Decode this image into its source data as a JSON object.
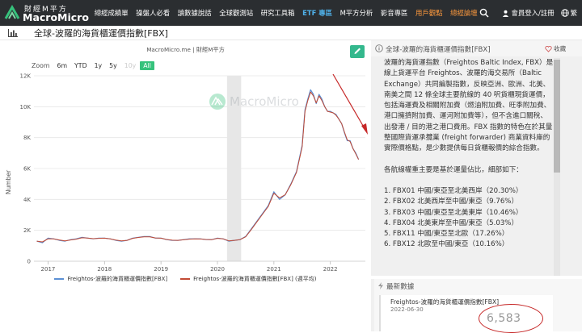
{
  "nav": {
    "logo_cn": "財經M平方",
    "logo_en": "MacroMicro",
    "items": [
      "總經成績單",
      "操盤人必看",
      "讀數據說話",
      "全球觀測站",
      "研究工具箱",
      "ETF 專區",
      "M平方分析",
      "影音專區",
      "用戶觀點",
      "總經論壇"
    ],
    "login": "會員登入/註冊",
    "lang": "繁"
  },
  "page": {
    "title": "全球-波羅的海貨櫃運價指數[FBX]"
  },
  "chart_header": {
    "source": "MacroMicro.me | 財經M平方",
    "zoom_label": "Zoom",
    "zoom_options": [
      "6m",
      "YTD",
      "1y",
      "5y",
      "10y",
      "All"
    ],
    "zoom_active": "All",
    "zoom_disabled": "10y",
    "watermark": "MacroMicro"
  },
  "chart_data": {
    "type": "line",
    "ylabel": "Number",
    "ylim": [
      0,
      12000
    ],
    "y_ticks": [
      "0",
      "2K",
      "4K",
      "6K",
      "8K",
      "10K",
      "12K"
    ],
    "x_ticks": [
      "2017",
      "2018",
      "2019",
      "2020",
      "2021",
      "2022"
    ],
    "x_tick_values": [
      2017,
      2018,
      2019,
      2020,
      2021,
      2022
    ],
    "xlim": [
      2016.75,
      2022.62
    ],
    "shaded_region": [
      2020.17,
      2020.42
    ],
    "series": [
      {
        "name": "Freightos-波羅的海貨櫃運價指數[FBX]",
        "color": "#5b8fd4",
        "x": [
          2016.8,
          2016.9,
          2017.0,
          2017.1,
          2017.2,
          2017.3,
          2017.4,
          2017.5,
          2017.6,
          2017.7,
          2017.8,
          2017.9,
          2018.0,
          2018.1,
          2018.2,
          2018.3,
          2018.4,
          2018.5,
          2018.6,
          2018.7,
          2018.8,
          2018.9,
          2019.0,
          2019.1,
          2019.2,
          2019.3,
          2019.4,
          2019.5,
          2019.6,
          2019.7,
          2019.8,
          2019.9,
          2020.0,
          2020.1,
          2020.2,
          2020.3,
          2020.4,
          2020.5,
          2020.6,
          2020.7,
          2020.8,
          2020.9,
          2021.0,
          2021.1,
          2021.2,
          2021.3,
          2021.4,
          2021.5,
          2021.55,
          2021.6,
          2021.65,
          2021.7,
          2021.75,
          2021.8,
          2021.85,
          2021.9,
          2021.95,
          2022.0,
          2022.05,
          2022.1,
          2022.15,
          2022.2,
          2022.25,
          2022.3,
          2022.35,
          2022.4,
          2022.45,
          2022.5
        ],
        "values": [
          1300,
          1200,
          1500,
          1450,
          1350,
          1300,
          1400,
          1450,
          1550,
          1500,
          1450,
          1500,
          1500,
          1450,
          1350,
          1300,
          1350,
          1500,
          1550,
          1600,
          1600,
          1500,
          1500,
          1400,
          1350,
          1350,
          1400,
          1450,
          1450,
          1450,
          1400,
          1400,
          1500,
          1450,
          1300,
          1350,
          1400,
          1600,
          2100,
          2600,
          3100,
          3600,
          4500,
          4000,
          4300,
          5000,
          5800,
          7500,
          9800,
          10500,
          11100,
          10800,
          10200,
          10800,
          10500,
          10000,
          9700,
          9700,
          9600,
          9500,
          9200,
          8900,
          8300,
          7800,
          7800,
          7300,
          7000,
          6583
        ]
      },
      {
        "name": "Freightos-波羅的海貨櫃運價指數[FBX] (週平均)",
        "color": "#c24a34",
        "x": [
          2016.8,
          2016.9,
          2017.0,
          2017.1,
          2017.2,
          2017.3,
          2017.4,
          2017.5,
          2017.6,
          2017.7,
          2017.8,
          2017.9,
          2018.0,
          2018.1,
          2018.2,
          2018.3,
          2018.4,
          2018.5,
          2018.6,
          2018.7,
          2018.8,
          2018.9,
          2019.0,
          2019.1,
          2019.2,
          2019.3,
          2019.4,
          2019.5,
          2019.6,
          2019.7,
          2019.8,
          2019.9,
          2020.0,
          2020.1,
          2020.2,
          2020.3,
          2020.4,
          2020.5,
          2020.6,
          2020.7,
          2020.8,
          2020.9,
          2021.0,
          2021.1,
          2021.2,
          2021.3,
          2021.4,
          2021.5,
          2021.55,
          2021.6,
          2021.65,
          2021.7,
          2021.75,
          2021.8,
          2021.85,
          2021.9,
          2021.95,
          2022.0,
          2022.05,
          2022.1,
          2022.15,
          2022.2,
          2022.25,
          2022.3,
          2022.35,
          2022.4,
          2022.45,
          2022.5
        ],
        "values": [
          1300,
          1250,
          1450,
          1450,
          1380,
          1320,
          1380,
          1430,
          1520,
          1500,
          1460,
          1480,
          1490,
          1450,
          1370,
          1320,
          1350,
          1480,
          1540,
          1580,
          1580,
          1510,
          1490,
          1410,
          1360,
          1350,
          1390,
          1430,
          1450,
          1440,
          1410,
          1400,
          1480,
          1450,
          1320,
          1350,
          1400,
          1580,
          2050,
          2550,
          3050,
          3550,
          4400,
          4100,
          4300,
          4950,
          5750,
          7400,
          9700,
          10400,
          10950,
          10700,
          10250,
          10700,
          10400,
          10000,
          9700,
          9650,
          9600,
          9450,
          9200,
          8900,
          8350,
          7850,
          7750,
          7300,
          6950,
          6583
        ]
      }
    ]
  },
  "right_panel": {
    "title": "全球-波羅的海貨櫃運價指數[FBX]",
    "fav_label": "收藏",
    "description": "波羅的海貨運指數（Freightos Baltic Index, FBX）是線上貨運平台 Freightos、波羅的海交易所（Baltic Exchange）共同編製指數，反映亞洲、歐洲、北美、南美之間 12 條全球主要航線的 40 呎貨櫃現貨運價，包括海運費及相關附加費（燃油附加費、旺季附加費、港口擁擠附加費、運河附加費等），但不含進口關稅、出發港 / 目的港之港口費用。FBX 指數的特色在於其量整國際貨運承攬業 (freight forwarder) 商業資料庫的實際價格點，是少數提供每日貨櫃報價的綜合指數。",
    "weights_intro": "各航線權重主要是基於運量佔比，細部如下：",
    "weights": [
      "1. FBX01 中國/東亞至北美西岸（20.30%）",
      "2. FBX02 北美西岸至中國/東亞（9.76%）",
      "3. FBX03 中國/東亞至北美東岸（10.46%）",
      "4. FBX04 北美東岸至中國/東亞（5.03%）",
      "5. FBX11 中國/東亞至北歐（17.26%）",
      "6. FBX12 北歐至中國/東亞（10.16%）"
    ],
    "latest_title": "最新數據",
    "latest_name": "Freightos-波羅的海貨櫃運價指數[FBX]",
    "latest_date": "2022-06-30",
    "latest_value": "6,583"
  },
  "colors": {
    "nav_bg": "#2b2e31",
    "accent_green": "#36c27c",
    "etf_blue": "#4fb0e8",
    "highlight_orange": "#ff9a3d",
    "annotation_red": "#c62828"
  }
}
